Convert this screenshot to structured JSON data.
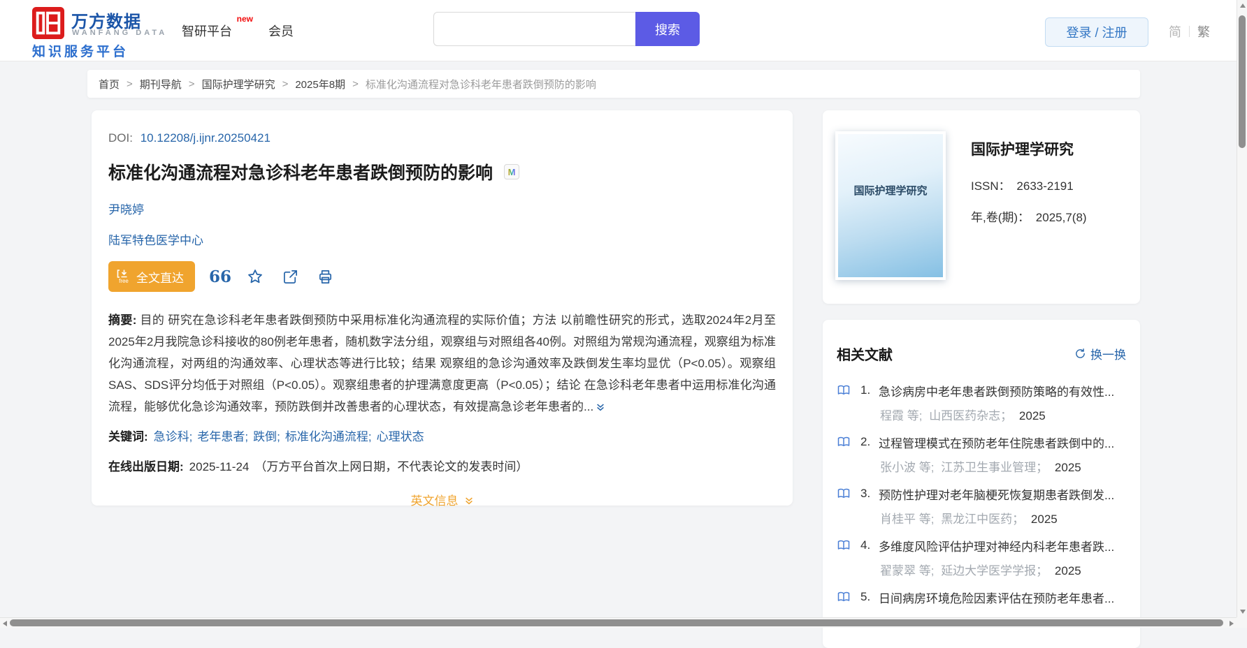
{
  "header": {
    "logo": {
      "brand_cn": "万方数据",
      "brand_en": "WANFANG DATA",
      "tagline": "知识服务平台"
    },
    "nav": [
      {
        "label": "智研平台",
        "badge": "new"
      },
      {
        "label": "会员",
        "badge": ""
      }
    ],
    "search": {
      "placeholder": "",
      "button_label": "搜索"
    },
    "login_label": "登录 / 注册",
    "lang": {
      "simplified": "简",
      "traditional": "繁"
    }
  },
  "breadcrumb": {
    "separator": ">",
    "items": [
      "首页",
      "期刊导航",
      "国际护理学研究",
      "2025年8期"
    ],
    "current": "标准化沟通流程对急诊科老年患者跌倒预防的影响"
  },
  "article": {
    "doi_label": "DOI:",
    "doi": "10.12208/j.ijnr.20250421",
    "title": "标准化沟通流程对急诊科老年患者跌倒预防的影响",
    "title_badge": "M",
    "author": "尹晓婷",
    "affiliation": "陆军特色医学中心",
    "fulltext_button_label": "全文直达",
    "fulltext_free_label": "free",
    "cite_icon_label": "66",
    "abstract_label": "摘要:",
    "abstract_text": "目的 研究在急诊科老年患者跌倒预防中采用标准化沟通流程的实际价值；方法 以前瞻性研究的形式，选取2024年2月至2025年2月我院急诊科接收的80例老年患者，随机数字法分组，观察组与对照组各40例。对照组为常规沟通流程，观察组为标准化沟通流程，对两组的沟通效率、心理状态等进行比较；结果 观察组的急诊沟通效率及跌倒发生率均显优（P<0.05）。观察组SAS、SDS评分均低于对照组（P<0.05）。观察组患者的护理满意度更高（P<0.05）；结论 在急诊科老年患者中运用标准化沟通流程，能够优化急诊沟通效率，预防跌倒并改善患者的心理状态，有效提高急诊老年患者的...",
    "keywords_label": "关键词:",
    "keywords": [
      "急诊科;",
      "老年患者;",
      "跌倒;",
      "标准化沟通流程;",
      "心理状态"
    ],
    "online_date_label": "在线出版日期:",
    "online_date": "2025-11-24",
    "online_date_note": "（万方平台首次上网日期，不代表论文的发表时间）",
    "english_info_label": "英文信息"
  },
  "journal": {
    "cover_text": "国际护理学研究",
    "name": "国际护理学研究",
    "issn_label": "ISSN：",
    "issn": "2633-2191",
    "volume_label": "年,卷(期)：",
    "volume": "2025,7(8)"
  },
  "related": {
    "title": "相关文献",
    "refresh_label": "换一换",
    "items": [
      {
        "num": "1.",
        "title": "急诊病房中老年患者跌倒预防策略的有效性...",
        "authors": "程霞 等;",
        "journal": "山西医药杂志；",
        "year": "2025"
      },
      {
        "num": "2.",
        "title": "过程管理模式在预防老年住院患者跌倒中的...",
        "authors": "张小波 等;",
        "journal": "江苏卫生事业管理；",
        "year": "2025"
      },
      {
        "num": "3.",
        "title": "预防性护理对老年脑梗死恢复期患者跌倒发...",
        "authors": "肖桂平 等;",
        "journal": "黑龙江中医药；",
        "year": "2025"
      },
      {
        "num": "4.",
        "title": "多维度风险评估护理对神经内科老年患者跌...",
        "authors": "翟蒙翠 等;",
        "journal": "延边大学医学学报；",
        "year": "2025"
      },
      {
        "num": "5.",
        "title": "日间病房环境危险因素评估在预防老年患者...",
        "authors": "",
        "journal": "",
        "year": ""
      }
    ]
  },
  "colors": {
    "brand-red": "#dc1c1c",
    "brand-blue": "#1b55a8",
    "tagline-blue": "#2d6fce",
    "link-blue": "#2866aa",
    "search-purple": "#5c5be5",
    "accent-orange": "#f0a42e"
  }
}
